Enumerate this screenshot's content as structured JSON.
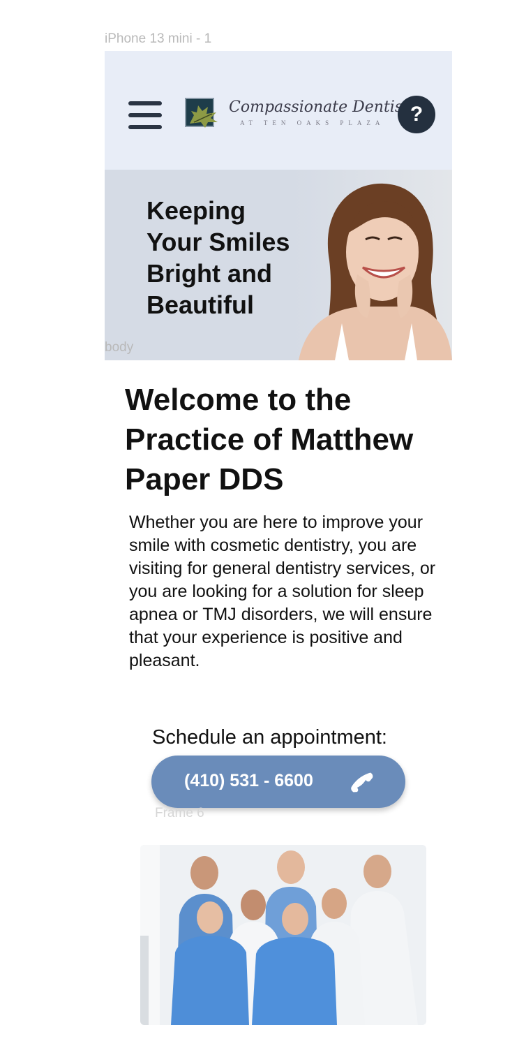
{
  "frame": {
    "title": "iPhone 13 mini - 1",
    "body_label": "body",
    "frame6_label": "Frame 6"
  },
  "header": {
    "logo_text": "Compassionate Dentistry",
    "logo_subtext": "AT TEN OAKS PLAZA",
    "help_label": "?",
    "icons": [
      "hamburger-menu-icon",
      "oak-leaf-logo-icon",
      "help-icon"
    ]
  },
  "hero": {
    "title": "Keeping Your Smiles Bright and Beautiful"
  },
  "welcome": {
    "title": "Welcome to the Practice of Matthew Paper DDS",
    "text": "Whether you are here to improve your smile with cosmetic dentistry, you are visiting for general dentistry services, or you are looking for a solution for sleep apnea or TMJ disorders, we will ensure that your experience is positive and pleasant."
  },
  "appointment": {
    "label": "Schedule an appointment:",
    "phone": "(410) 531 - 6600",
    "icon": "phone-icon"
  },
  "colors": {
    "header_bg": "#e8edf7",
    "hero_bg": "#d5dbe5",
    "button_bg": "#6a8cba",
    "dark": "#24303f"
  }
}
